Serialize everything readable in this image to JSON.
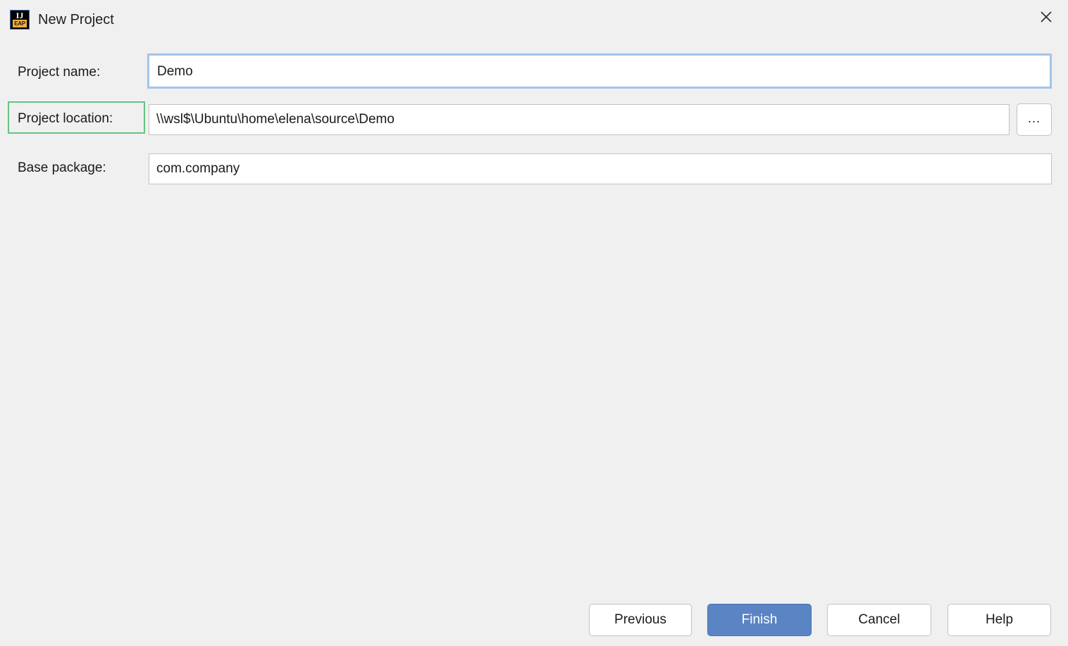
{
  "window": {
    "title": "New Project",
    "icon": "intellij-idea-eap-icon",
    "icon_primary_text": "IJ",
    "icon_badge_text": "EAP",
    "close_icon": "close-icon"
  },
  "colors": {
    "background": "#f0f0f0",
    "field_border": "#c2c2c2",
    "focus_ring": "#a3c4e8",
    "highlight_box": "#67c383",
    "default_button": "#5b84c4",
    "icon_badge": "#f4af3d"
  },
  "form": {
    "project_name": {
      "label": "Project name:",
      "value": "Demo",
      "placeholder": ""
    },
    "project_location": {
      "label": "Project location:",
      "value": "\\\\wsl$\\Ubuntu\\home\\elena\\source\\Demo",
      "placeholder": "",
      "browse_label": "..."
    },
    "base_package": {
      "label": "Base package:",
      "value": "com.company",
      "placeholder": ""
    }
  },
  "footer": {
    "previous_label": "Previous",
    "finish_label": "Finish",
    "cancel_label": "Cancel",
    "help_label": "Help"
  }
}
